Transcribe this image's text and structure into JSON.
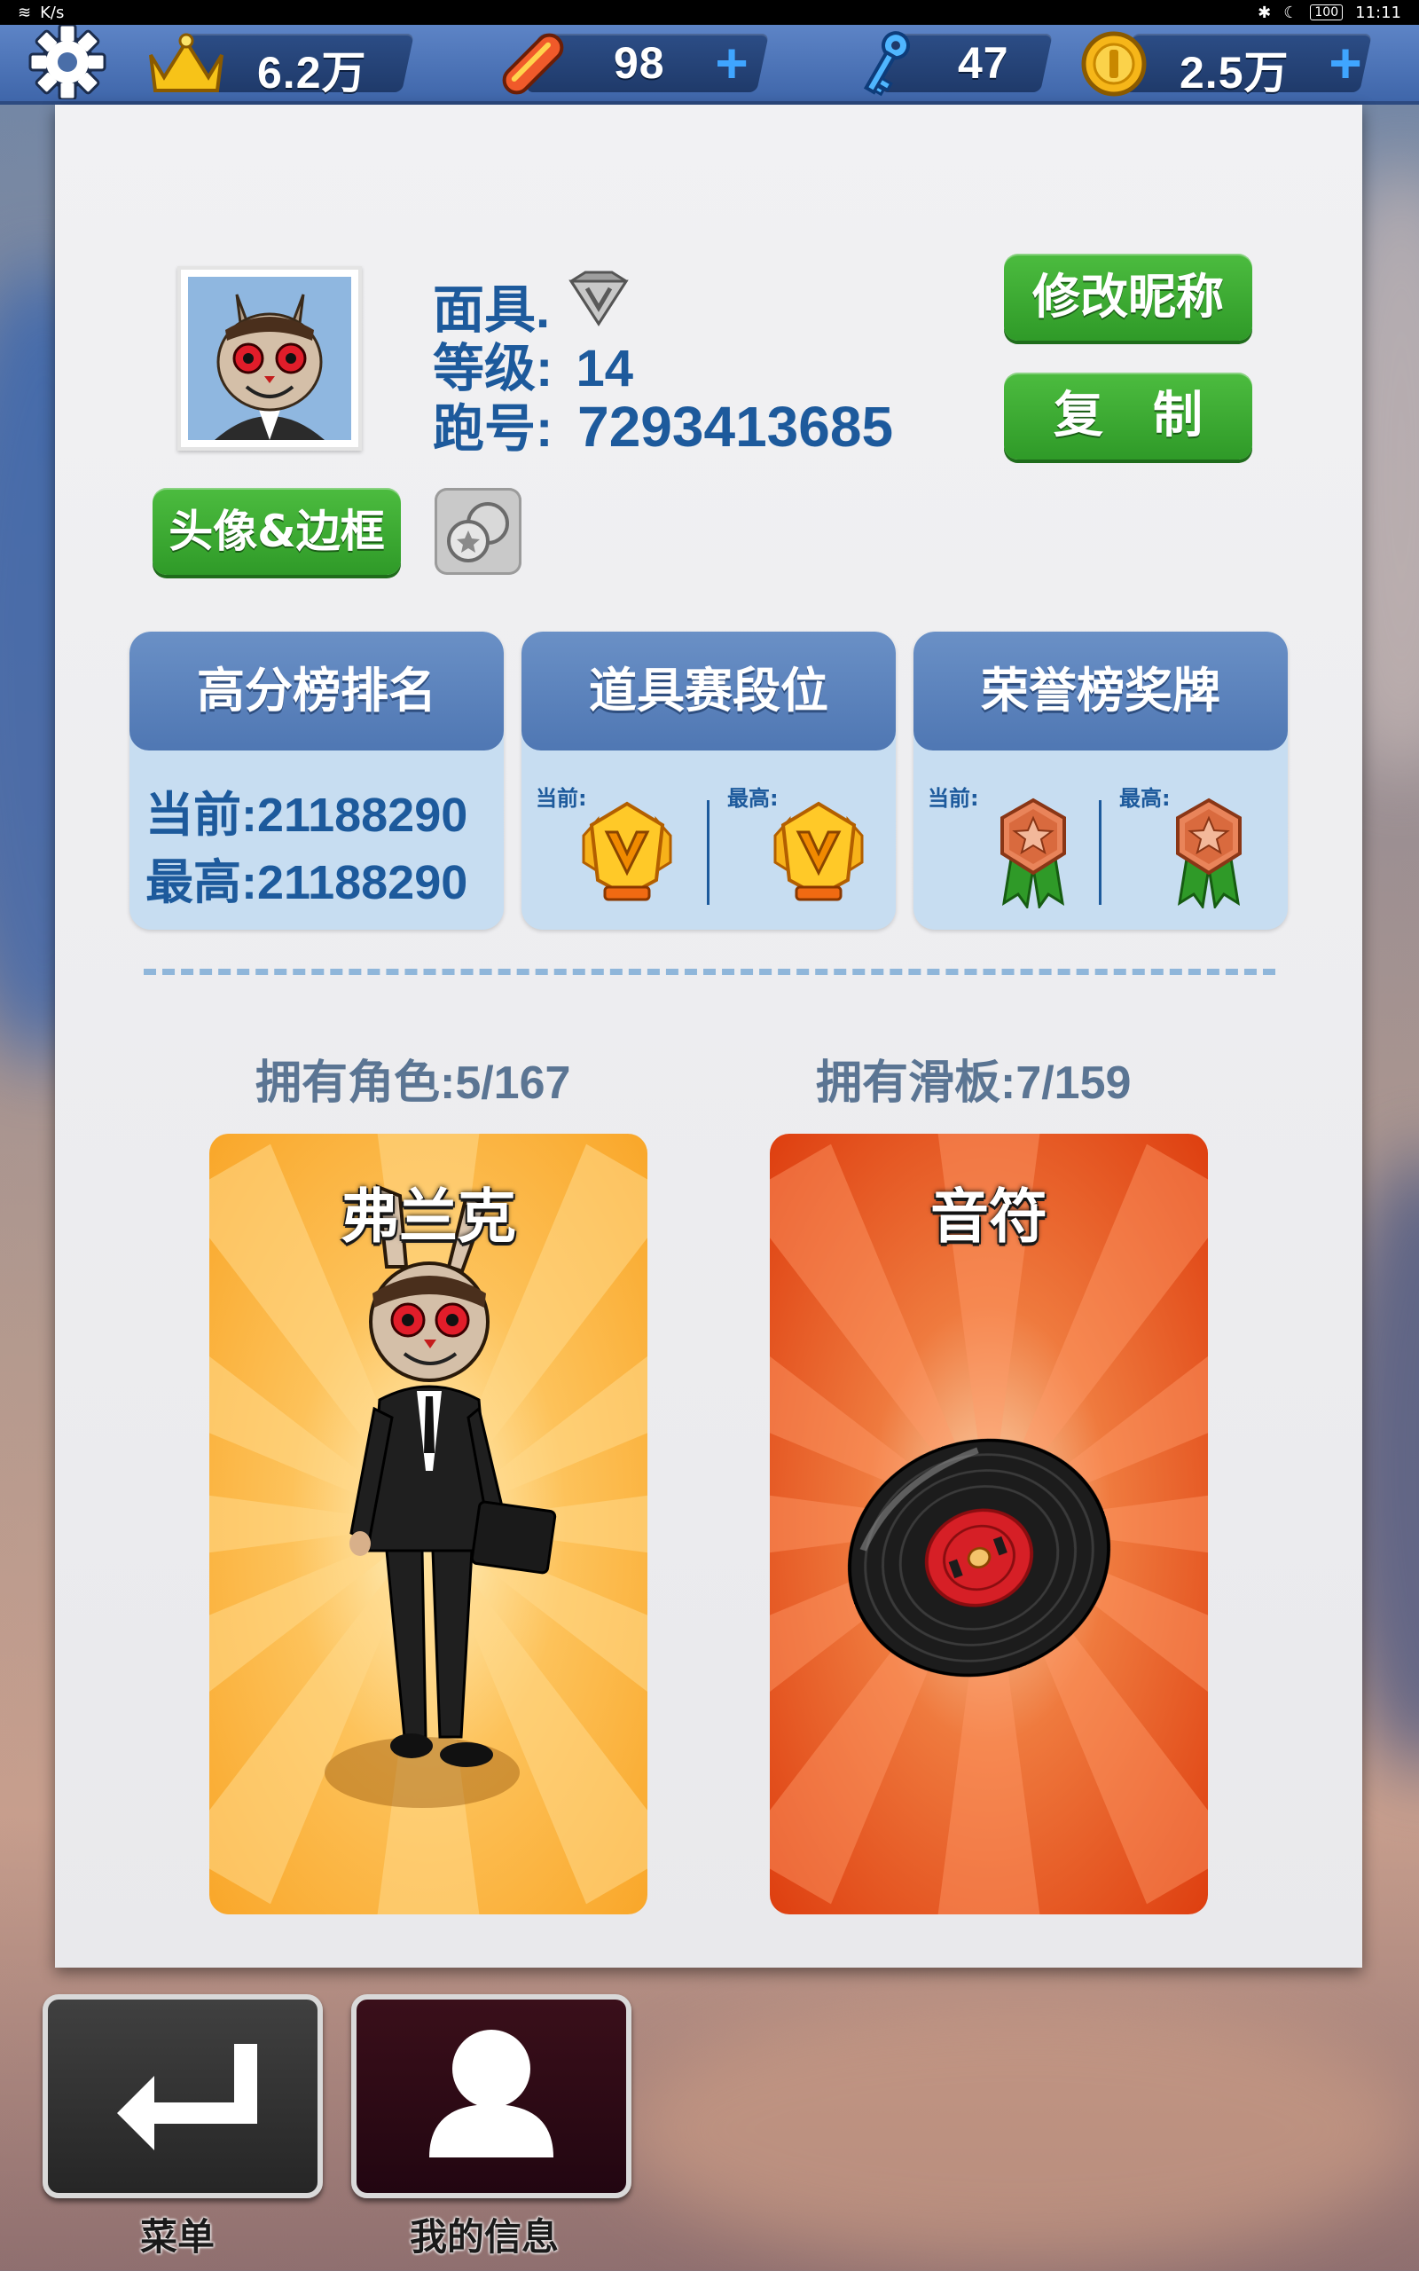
{
  "status_bar": {
    "network_speed": "K/s",
    "time": "11:11",
    "battery": "100"
  },
  "resources": {
    "crowns": "6.2万",
    "hoverboards": "98",
    "keys": "47",
    "coins": "2.5万",
    "icons": [
      "gear-icon",
      "crown-icon",
      "hoverboard-icon",
      "key-icon",
      "coin-icon",
      "plus-icon"
    ]
  },
  "profile": {
    "name": "面具.",
    "level_label": "等级:",
    "level": "14",
    "id_label": "跑号:",
    "id": "7293413685",
    "rename_button": "修改昵称",
    "copy_button": "复　制",
    "avatar_button": "头像&边框"
  },
  "rank_cards": {
    "high_score": {
      "title": "高分榜排名",
      "current": "当前:21188290",
      "best": "最高:21188290"
    },
    "powerup_league": {
      "title": "道具赛段位",
      "current_label": "当前:",
      "best_label": "最高:"
    },
    "honor_medal": {
      "title": "荣誉榜奖牌",
      "current_label": "当前:",
      "best_label": "最高:"
    }
  },
  "collection": {
    "characters_label": "拥有角色:5/167",
    "boards_label": "拥有滑板:7/159",
    "character_name": "弗兰克",
    "board_name": "音符"
  },
  "bottom_nav": {
    "menu_label": "菜单",
    "my_info_label": "我的信息"
  },
  "colors": {
    "accent_blue": "#1d5a9c",
    "green_button": "#3aa831",
    "topbar": "#4a72b6",
    "character_bg": "#fbb040",
    "board_bg": "#e2461a"
  }
}
